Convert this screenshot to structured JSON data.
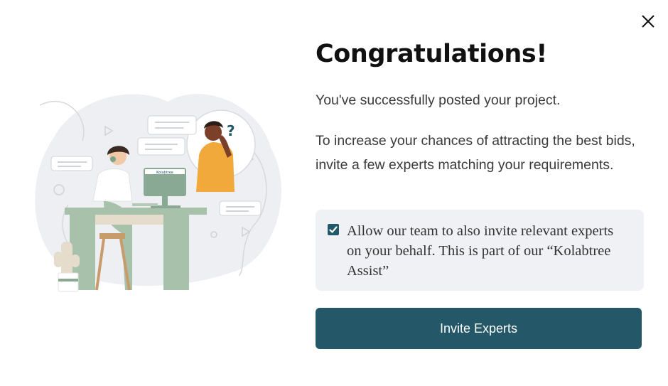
{
  "dialog": {
    "close_icon": "close-icon",
    "title": "Congratulations!",
    "message_primary": "You've successfully posted your project.",
    "message_secondary": "To increase your chances of attracting the best bids, invite a few experts matching your requirements.",
    "consent": {
      "checked": true,
      "label": "Allow our team to also invite relevant experts on your behalf. This is part of our “Kolabtree Assist”"
    },
    "primary_button_label": "Invite Experts",
    "illustration": {
      "description_icon": "people-collaborating-illustration",
      "monitor_brand": "Kolabtree"
    }
  },
  "colors": {
    "accent": "#245868",
    "panel_bg": "#f0f1f4",
    "checkbox": "#21596a",
    "text": "#3a3a3a",
    "title": "#111111"
  }
}
